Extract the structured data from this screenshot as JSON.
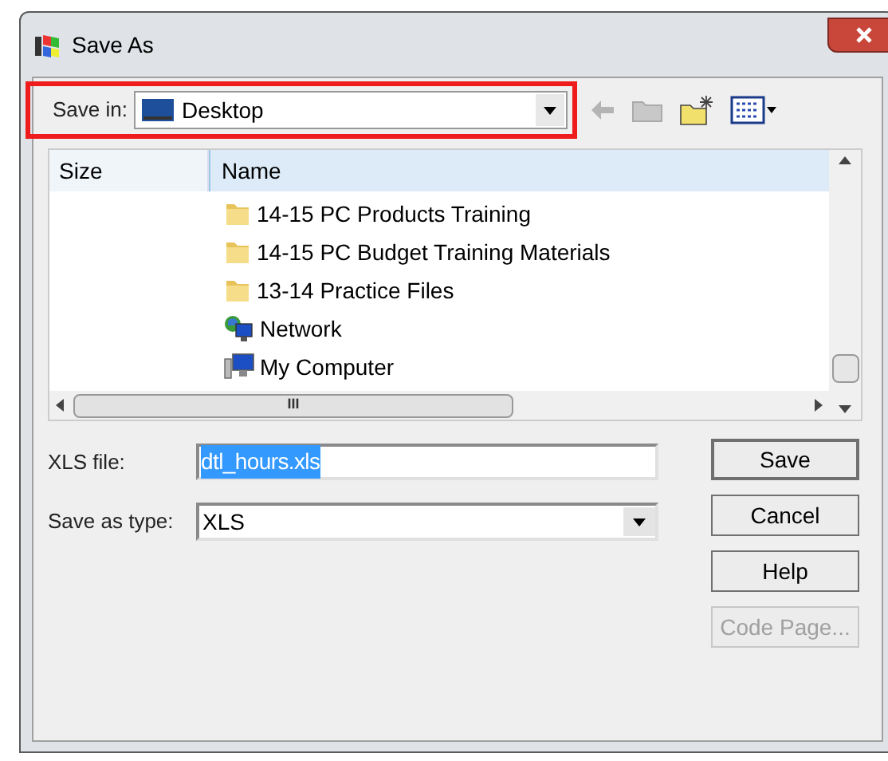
{
  "window": {
    "title": "Save As"
  },
  "save_in": {
    "label": "Save in:",
    "value": "Desktop",
    "highlighted": true
  },
  "file_list": {
    "columns": [
      "Size",
      "Name"
    ],
    "rows": [
      {
        "name": "14-15 PC Products Training",
        "kind": "folder"
      },
      {
        "name": "14-15 PC Budget Training Materials",
        "kind": "folder"
      },
      {
        "name": "13-14 Practice Files",
        "kind": "folder"
      },
      {
        "name": "Network",
        "kind": "network"
      },
      {
        "name": "My Computer",
        "kind": "computer"
      }
    ],
    "hscroll_grip": "III"
  },
  "file_name": {
    "label": "XLS file:",
    "value": "dtl_hours.xls",
    "text_selected": true
  },
  "file_type": {
    "label": "Save as type:",
    "value": "XLS"
  },
  "buttons": [
    {
      "label": "Save",
      "disabled": false,
      "default": true
    },
    {
      "label": "Cancel",
      "disabled": false,
      "default": false
    },
    {
      "label": "Help",
      "disabled": false,
      "default": false
    },
    {
      "label": "Code Page...",
      "disabled": true,
      "default": false
    }
  ]
}
